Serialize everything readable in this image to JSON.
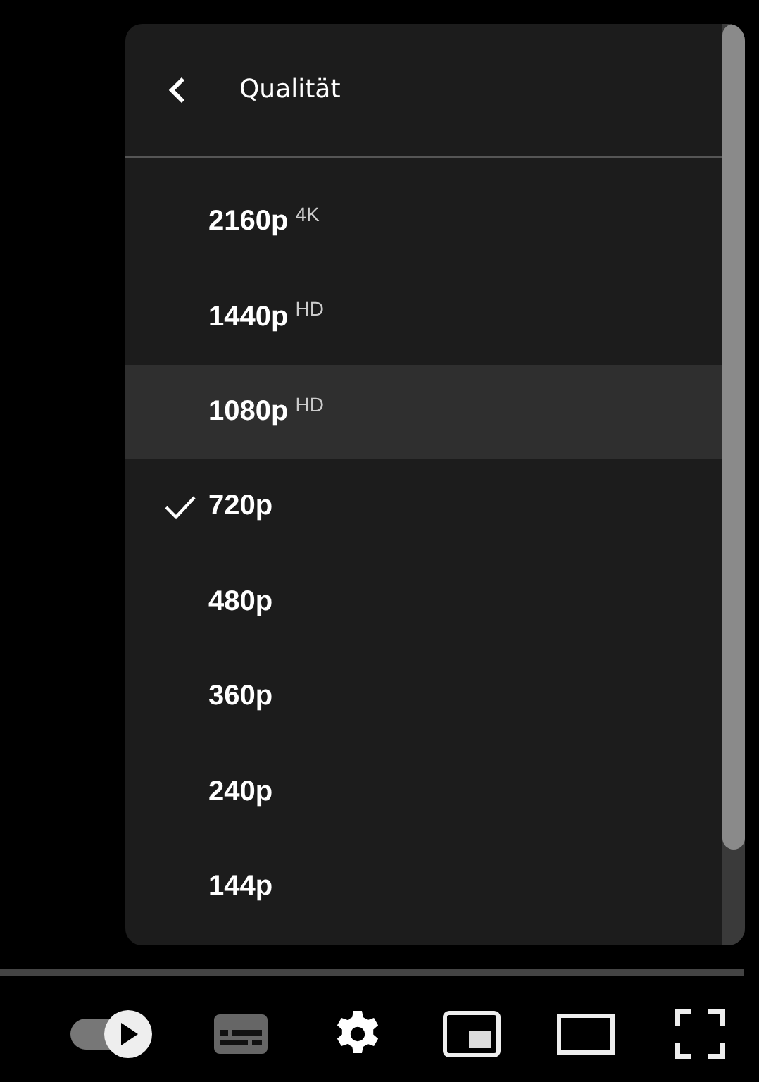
{
  "menu": {
    "title": "Qualität",
    "items": [
      {
        "label": "2160p",
        "badge": "4K",
        "checked": false,
        "highlighted": false
      },
      {
        "label": "1440p",
        "badge": "HD",
        "checked": false,
        "highlighted": false
      },
      {
        "label": "1080p",
        "badge": "HD",
        "checked": false,
        "highlighted": true
      },
      {
        "label": "720p",
        "checked": true,
        "highlighted": false
      },
      {
        "label": "480p",
        "checked": false,
        "highlighted": false
      },
      {
        "label": "360p",
        "checked": false,
        "highlighted": false
      },
      {
        "label": "240p",
        "checked": false,
        "highlighted": false
      },
      {
        "label": "144p",
        "checked": false,
        "highlighted": false
      }
    ]
  },
  "controls": [
    {
      "kind": "autoplay"
    },
    {
      "kind": "subtitles"
    },
    {
      "kind": "settings"
    },
    {
      "kind": "miniplayer"
    },
    {
      "kind": "theater"
    },
    {
      "kind": "fullscreen"
    }
  ]
}
